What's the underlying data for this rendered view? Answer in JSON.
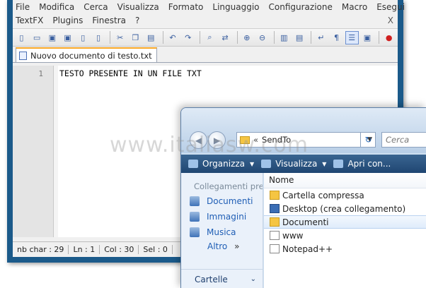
{
  "npp": {
    "menu": [
      "File",
      "Modifica",
      "Cerca",
      "Visualizza",
      "Formato",
      "Linguaggio",
      "Configurazione",
      "Macro",
      "Esegui"
    ],
    "menu2": [
      "TextFX",
      "Plugins",
      "Finestra",
      "?"
    ],
    "close_x": "X",
    "tab_label": "Nuovo documento di testo.txt",
    "line_number": "1",
    "code_line": "TESTO PRESENTE IN UN FILE TXT",
    "status": {
      "chars": "nb char : 29",
      "line": "Ln : 1",
      "col": "Col : 30",
      "sel": "Sel : 0"
    }
  },
  "watermark": "www.italiasw.com",
  "dialog": {
    "address_arrows": "«",
    "address_path": "SendTo",
    "search_placeholder": "Cerca",
    "commands": {
      "organizza": "Organizza",
      "visualizza": "Visualizza",
      "apri_con": "Apri con..."
    },
    "nav_header": "Collegamenti preferiti",
    "favorites": [
      "Documenti",
      "Immagini",
      "Musica"
    ],
    "altro": "Altro",
    "altro_arrows": "»",
    "cartelle": "Cartelle",
    "column_header": "Nome",
    "files": [
      "Cartella compressa",
      "Desktop (crea collegamento)",
      "Documenti",
      "www",
      "Notepad++"
    ],
    "selected_file": "Documenti"
  }
}
